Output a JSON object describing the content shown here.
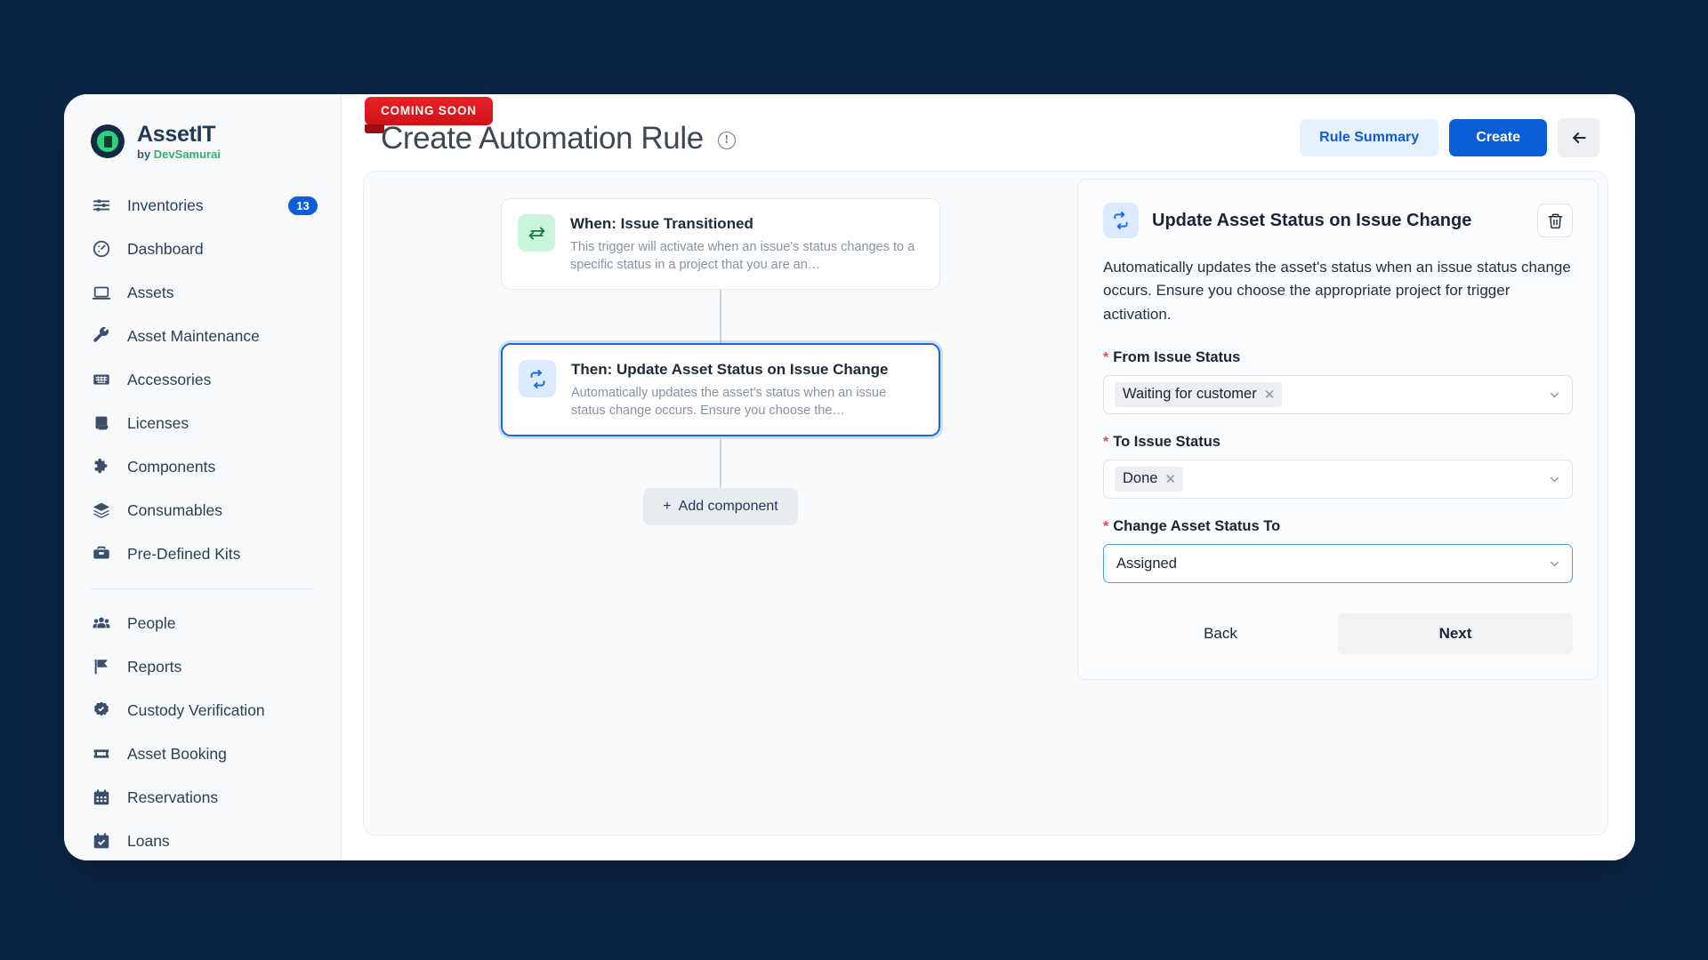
{
  "brand": {
    "name": "AssetIT",
    "by_prefix": "by ",
    "by_name": "DevSamurai",
    "logo_icon": "assetit-logo-icon"
  },
  "sidebar": {
    "items": [
      {
        "label": "Inventories",
        "icon": "sliders-icon",
        "badge": "13"
      },
      {
        "label": "Dashboard",
        "icon": "gauge-icon"
      },
      {
        "label": "Assets",
        "icon": "laptop-icon"
      },
      {
        "label": "Asset Maintenance",
        "icon": "wrench-icon"
      },
      {
        "label": "Accessories",
        "icon": "keyboard-icon"
      },
      {
        "label": "Licenses",
        "icon": "scroll-icon"
      },
      {
        "label": "Components",
        "icon": "puzzle-icon"
      },
      {
        "label": "Consumables",
        "icon": "layers-icon"
      },
      {
        "label": "Pre-Defined Kits",
        "icon": "toolbox-icon"
      }
    ],
    "items_secondary": [
      {
        "label": "People",
        "icon": "people-icon"
      },
      {
        "label": "Reports",
        "icon": "flag-icon"
      },
      {
        "label": "Custody Verification",
        "icon": "badge-check-icon"
      },
      {
        "label": "Asset Booking",
        "icon": "ticket-icon"
      },
      {
        "label": "Reservations",
        "icon": "calendar-icon"
      },
      {
        "label": "Loans",
        "icon": "calendar-check-icon"
      }
    ]
  },
  "header": {
    "ribbon": "COMING SOON",
    "title": "Create Automation Rule",
    "info_icon": "info-icon",
    "rule_summary_label": "Rule Summary",
    "create_label": "Create",
    "back_arrow_icon": "arrow-left-icon"
  },
  "flow": {
    "cards": [
      {
        "title": "When: Issue Transitioned",
        "desc": "This trigger will activate when an issue's status changes to a specific status in a project that you are an…",
        "icon": "transfer-arrows-icon",
        "icon_color": "green",
        "selected": false
      },
      {
        "title": "Then: Update Asset Status on Issue Change",
        "desc": "Automatically updates the asset's status when an issue status change occurs. Ensure you choose the…",
        "icon": "refresh-arrows-icon",
        "icon_color": "blue",
        "selected": true
      }
    ],
    "add_component_label": "Add component",
    "add_component_icon": "plus-icon"
  },
  "details": {
    "icon": "refresh-arrows-icon",
    "title": "Update Asset Status on Issue Change",
    "delete_icon": "trash-icon",
    "description": "Automatically updates the asset's status when an issue status change occurs. Ensure you choose the appropriate project for trigger activation.",
    "fields": [
      {
        "label": "From Issue Status",
        "required": true,
        "type": "multiselect",
        "chip": "Waiting for customer",
        "chip_remove_icon": "close-icon",
        "chevron_icon": "chevron-down-icon",
        "focused": false
      },
      {
        "label": "To Issue Status",
        "required": true,
        "type": "multiselect",
        "chip": "Done",
        "chip_remove_icon": "close-icon",
        "chevron_icon": "chevron-down-icon",
        "focused": false
      },
      {
        "label": "Change Asset Status To",
        "required": true,
        "type": "select",
        "value": "Assigned",
        "chevron_icon": "chevron-down-icon",
        "focused": true
      }
    ],
    "back_label": "Back",
    "next_label": "Next"
  },
  "colors": {
    "page_background": "#0a2647",
    "accent_blue": "#0b5ed7",
    "ribbon_red": "#ea2027",
    "brand_green": "#2fb36b",
    "required_red": "#e5484d"
  }
}
